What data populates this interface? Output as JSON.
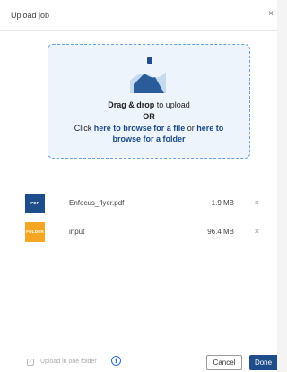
{
  "dialog": {
    "title": "Upload job",
    "close_glyph": "×"
  },
  "dropzone": {
    "icon": "upload-image-icon",
    "drag_bold": "Drag & drop",
    "drag_rest": " to upload",
    "or": "OR",
    "click": "Click ",
    "browse_file_link": "here to browse for a file",
    "or_small": " or ",
    "here_to": "here to",
    "browse_folder_link": "browse for a folder",
    "colors": {
      "border": "#6aa2d9",
      "background": "#eef4fb",
      "icon": "#2a5c99"
    }
  },
  "files": [
    {
      "badge": "PDF",
      "badge_color": "#1e4d8c",
      "name": "Enfocus_flyer.pdf",
      "size": "1.9 MB",
      "remove": "×"
    },
    {
      "badge": "FOLDER",
      "badge_color": "#f5a623",
      "name": "input",
      "size": "96.4 MB",
      "remove": "×"
    }
  ],
  "footer": {
    "checkbox_checked": true,
    "checkbox_label": "Upload in one folder",
    "info_icon": "i",
    "cancel_label": "Cancel",
    "done_label": "Done",
    "primary_color": "#1e4d8c"
  }
}
